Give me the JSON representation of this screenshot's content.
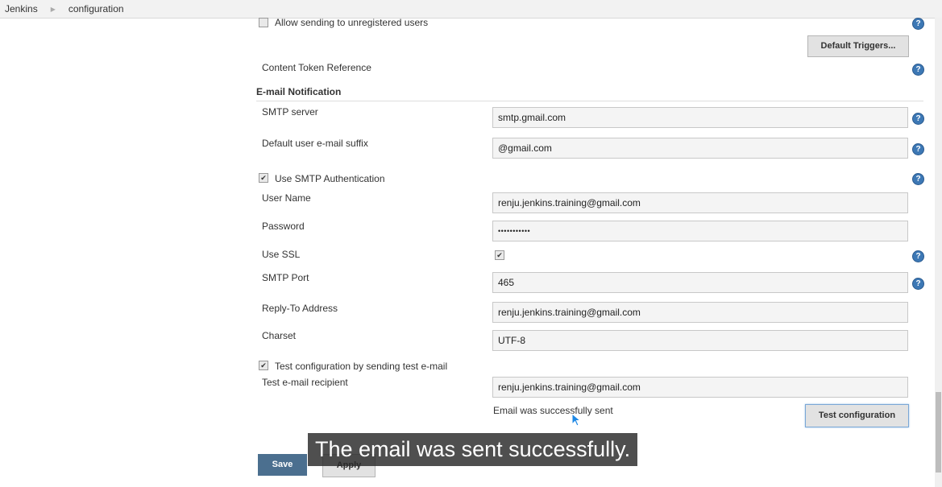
{
  "breadcrumb": {
    "items": [
      "Jenkins",
      "configuration"
    ]
  },
  "top": {
    "allow_unregistered_label": "Allow sending to unregistered users",
    "default_triggers_button": "Default Triggers...",
    "content_token_label": "Content Token Reference"
  },
  "email": {
    "section_title": "E-mail Notification",
    "smtp_server_label": "SMTP server",
    "smtp_server_value": "smtp.gmail.com",
    "suffix_label": "Default user e-mail suffix",
    "suffix_value": "@gmail.com",
    "use_auth_label": "Use SMTP Authentication",
    "username_label": "User Name",
    "username_value": "renju.jenkins.training@gmail.com",
    "password_label": "Password",
    "password_value": "•••••••••••",
    "use_ssl_label": "Use SSL",
    "port_label": "SMTP Port",
    "port_value": "465",
    "reply_to_label": "Reply-To Address",
    "reply_to_value": "renju.jenkins.training@gmail.com",
    "charset_label": "Charset",
    "charset_value": "UTF-8",
    "test_config_label": "Test configuration by sending test e-mail",
    "test_recipient_label": "Test e-mail recipient",
    "test_recipient_value": "renju.jenkins.training@gmail.com",
    "status_message": "Email was successfully sent",
    "test_button": "Test configuration"
  },
  "footer": {
    "save_button": "Save",
    "apply_button": "Apply"
  },
  "overlay": {
    "subtitle": "The email was sent successfully."
  },
  "colors": {
    "save_button": "#4b6f8f",
    "help_icon": "#3d78b5",
    "cursor": "#1e88e5"
  },
  "checkbox_glyph": "✔",
  "help_glyph": "?"
}
